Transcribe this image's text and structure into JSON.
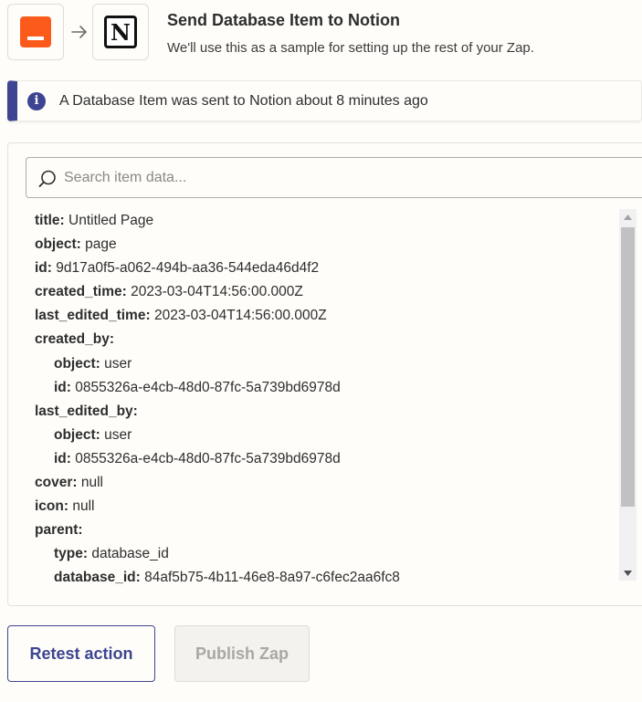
{
  "header": {
    "title": "Send Database Item to Notion",
    "subtitle": "We'll use this as a sample for setting up the rest of your Zap.",
    "trigger_icon": "orange-app-icon",
    "action_icon": "notion-icon",
    "notion_letter": "N",
    "colors": {
      "trigger": "#fc5a1a",
      "notion": "#111111"
    }
  },
  "banner": {
    "text": "A Database Item was sent to Notion about 8 minutes ago",
    "icon": "info-icon",
    "accent": "#3d4592"
  },
  "search": {
    "placeholder": "Search item data...",
    "value": ""
  },
  "rows": [
    {
      "key": "title:",
      "value": "Untitled Page",
      "indent": false
    },
    {
      "key": "object:",
      "value": "page",
      "indent": false
    },
    {
      "key": "id:",
      "value": "9d17a0f5-a062-494b-aa36-544eda46d4f2",
      "indent": false
    },
    {
      "key": "created_time:",
      "value": "2023-03-04T14:56:00.000Z",
      "indent": false
    },
    {
      "key": "last_edited_time:",
      "value": "2023-03-04T14:56:00.000Z",
      "indent": false
    },
    {
      "key": "created_by:",
      "value": "",
      "indent": false
    },
    {
      "key": "object:",
      "value": "user",
      "indent": true
    },
    {
      "key": "id:",
      "value": "0855326a-e4cb-48d0-87fc-5a739bd6978d",
      "indent": true
    },
    {
      "key": "last_edited_by:",
      "value": "",
      "indent": false
    },
    {
      "key": "object:",
      "value": "user",
      "indent": true
    },
    {
      "key": "id:",
      "value": "0855326a-e4cb-48d0-87fc-5a739bd6978d",
      "indent": true
    },
    {
      "key": "cover:",
      "value": "null",
      "indent": false
    },
    {
      "key": "icon:",
      "value": "null",
      "indent": false
    },
    {
      "key": "parent:",
      "value": "",
      "indent": false
    },
    {
      "key": "type:",
      "value": "database_id",
      "indent": true
    },
    {
      "key": "database_id:",
      "value": "84af5b75-4b11-46e8-8a97-c6fec2aa6fc8",
      "indent": true
    }
  ],
  "buttons": {
    "retest": "Retest action",
    "publish": "Publish Zap"
  }
}
